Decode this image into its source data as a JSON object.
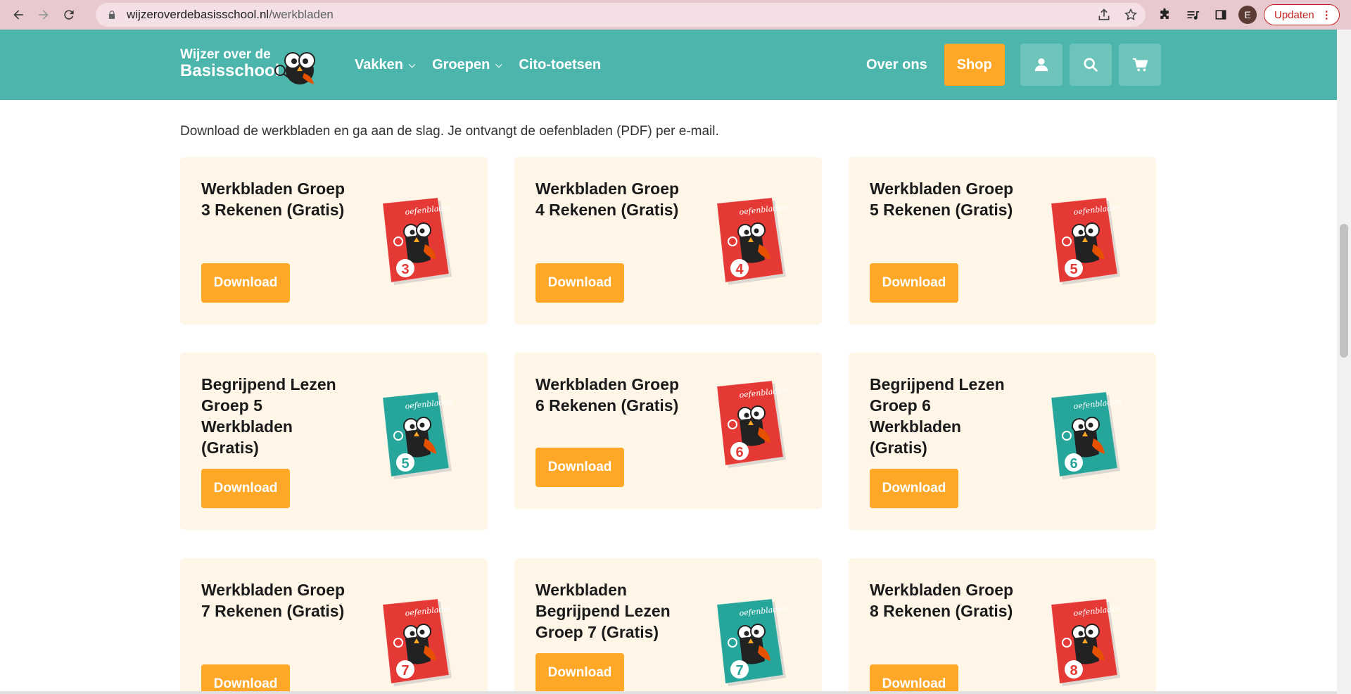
{
  "browser": {
    "url_host": "wijzeroverdebasisschool.nl",
    "url_path": "/werkbladen",
    "avatar_letter": "E",
    "update_label": "Updaten"
  },
  "header": {
    "logo_line1": "Wijzer over de",
    "logo_line2": "Basisschool",
    "menu": [
      {
        "label": "Vakken",
        "has_dropdown": true
      },
      {
        "label": "Groepen",
        "has_dropdown": true
      },
      {
        "label": "Cito-toetsen",
        "has_dropdown": false
      }
    ],
    "over_ons": "Over ons",
    "shop": "Shop",
    "icons": [
      "user-icon",
      "search-icon",
      "cart-icon"
    ]
  },
  "intro": "Download de werkbladen en ga aan de slag. Je ontvangt de oefenbladen (PDF) per e-mail.",
  "colors": {
    "header_bg": "#4db6ac",
    "accent": "#ffa726",
    "card_bg": "#fff6e8",
    "book_red": "#e53935",
    "book_teal": "#26a69a"
  },
  "cards": [
    {
      "title": "Werkbladen Groep 3 Rekenen (Gratis)",
      "button": "Download",
      "book_color": "red",
      "book_number": "3"
    },
    {
      "title": "Werkbladen Groep 4 Rekenen (Gratis)",
      "button": "Download",
      "book_color": "red",
      "book_number": "4"
    },
    {
      "title": "Werkbladen Groep 5 Rekenen (Gratis)",
      "button": "Download",
      "book_color": "red",
      "book_number": "5"
    },
    {
      "title": "Begrijpend Lezen Groep 5 Werkbladen (Gratis)",
      "button": "Download",
      "book_color": "teal",
      "book_number": "5"
    },
    {
      "title": "Werkbladen Groep 6 Rekenen (Gratis)",
      "button": "Download",
      "book_color": "red",
      "book_number": "6"
    },
    {
      "title": "Begrijpend Lezen Groep 6 Werkbladen (Gratis)",
      "button": "Download",
      "book_color": "teal",
      "book_number": "6"
    },
    {
      "title": "Werkbladen Groep 7 Rekenen (Gratis)",
      "button": "Download",
      "book_color": "red",
      "book_number": "7"
    },
    {
      "title": "Werkbladen Begrijpend Lezen Groep 7 (Gratis)",
      "button": "Download",
      "book_color": "teal",
      "book_number": "7"
    },
    {
      "title": "Werkbladen Groep 8 Rekenen (Gratis)",
      "button": "Download",
      "book_color": "red",
      "book_number": "8"
    }
  ]
}
